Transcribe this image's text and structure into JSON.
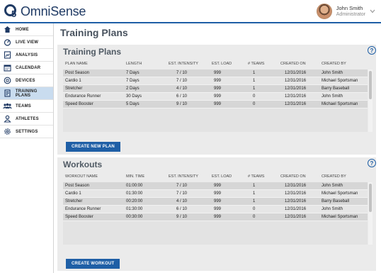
{
  "app": {
    "brand": "OmniSense"
  },
  "user": {
    "name": "John Smith",
    "role": "Administrator"
  },
  "sidebar": {
    "items": [
      {
        "label": "HOME",
        "icon": "home-icon"
      },
      {
        "label": "LIVE VIEW",
        "icon": "live-view-icon"
      },
      {
        "label": "ANALYSIS",
        "icon": "analysis-icon"
      },
      {
        "label": "CALENDAR",
        "icon": "calendar-icon"
      },
      {
        "label": "DEVICES",
        "icon": "devices-icon"
      },
      {
        "label": "TRAINING PLANS",
        "icon": "training-plans-icon",
        "active": true
      },
      {
        "label": "TEAMS",
        "icon": "teams-icon"
      },
      {
        "label": "ATHLETES",
        "icon": "athletes-icon"
      },
      {
        "label": "SETTINGS",
        "icon": "settings-icon"
      }
    ]
  },
  "page": {
    "title": "Training Plans"
  },
  "training_plans": {
    "title": "Training Plans",
    "columns": [
      "PLAN NAME",
      "LENGTH",
      "EST. INTENSITY",
      "EST. LOAD",
      "# TEAMS",
      "CREATED ON",
      "CREATED BY"
    ],
    "rows": [
      [
        "Post Season",
        "7 Days",
        "7 / 10",
        "999",
        "1",
        "12/31/2016",
        "John Smith"
      ],
      [
        "Cardio 1",
        "7 Days",
        "7 / 10",
        "999",
        "1",
        "12/31/2016",
        "Michael Sportsman"
      ],
      [
        "Stretcher",
        "2 Days",
        "4 / 10",
        "999",
        "1",
        "12/31/2016",
        "Barry Baseball"
      ],
      [
        "Endurance Runner",
        "30 Days",
        "6 / 10",
        "999",
        "0",
        "12/31/2016",
        "John Smith"
      ],
      [
        "Speed Booster",
        "5 Days",
        "9 / 10",
        "999",
        "0",
        "12/31/2016",
        "Michael Sportsman"
      ]
    ],
    "button": "CREATE NEW PLAN"
  },
  "workouts": {
    "title": "Workouts",
    "columns": [
      "WORKOUT NAME",
      "MIN. TIME",
      "EST. INTENSITY",
      "EST. LOAD",
      "# TEAMS",
      "CREATED ON",
      "CREATED BY"
    ],
    "rows": [
      [
        "Post Season",
        "01:00:00",
        "7 / 10",
        "999",
        "1",
        "12/31/2016",
        "John Smith"
      ],
      [
        "Cardio 1",
        "01:30:00",
        "7 / 10",
        "999",
        "1",
        "12/31/2016",
        "Michael Sportsman"
      ],
      [
        "Stretcher",
        "00:20:00",
        "4 / 10",
        "999",
        "1",
        "12/31/2016",
        "Barry Baseball"
      ],
      [
        "Endurance Runner",
        "01:30:00",
        "6 / 10",
        "999",
        "0",
        "12/31/2016",
        "John Smith"
      ],
      [
        "Speed Booster",
        "00:30:00",
        "9 / 10",
        "999",
        "0",
        "12/31/2016",
        "Michael Sportsman"
      ]
    ],
    "button": "CREATE WORKOUT"
  },
  "help_glyph": "?",
  "colors": {
    "accent": "#1f5fa6",
    "brand": "#1f3a64",
    "active_nav": "#c9dcef",
    "panel_bg": "#ebebeb"
  }
}
